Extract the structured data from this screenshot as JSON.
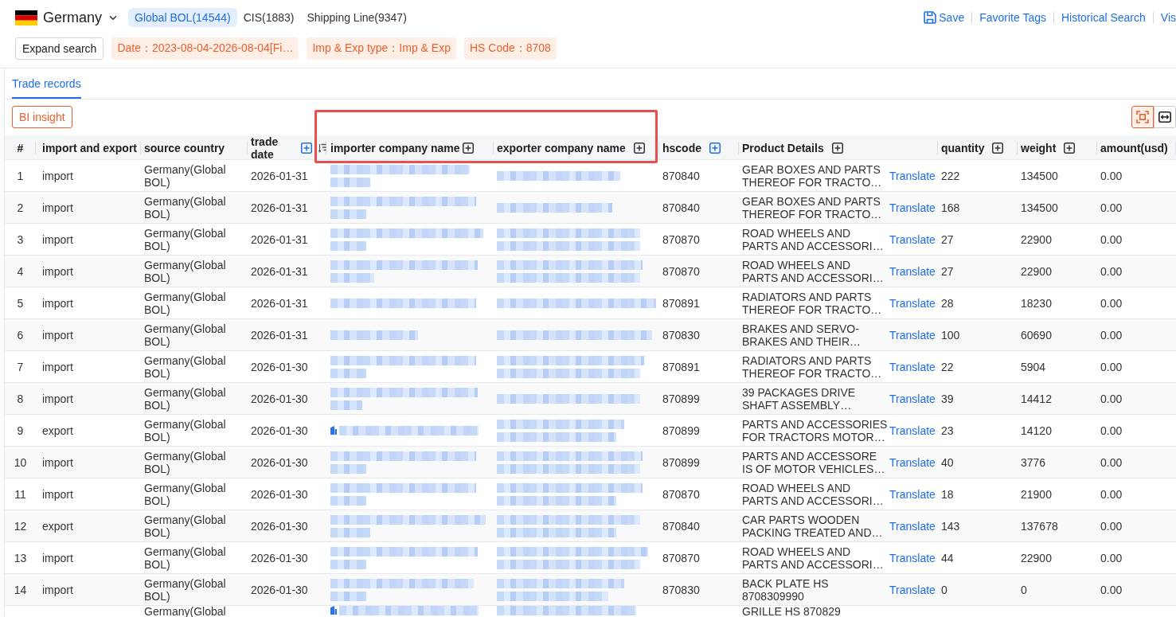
{
  "top_bar": {
    "country": "Germany",
    "source_tabs": [
      {
        "label": "Global BOL(14544)",
        "selected": true
      },
      {
        "label": "CIS(1883)",
        "selected": false
      },
      {
        "label": "Shipping Line(9347)",
        "selected": false
      }
    ],
    "links": [
      {
        "label": "Save",
        "kind": "save"
      },
      {
        "label": "Favorite Tags",
        "kind": "plain"
      },
      {
        "label": "Historical Search",
        "kind": "plain"
      },
      {
        "label": "Vis",
        "kind": "plain"
      }
    ],
    "expand_button": "Expand search",
    "filters": [
      "Date：2023-08-04-2026-08-04[Fi…",
      "Imp & Exp type：Imp & Exp",
      "HS Code：8708"
    ]
  },
  "record_tabs": [
    {
      "label": "Trade records",
      "selected": true
    }
  ],
  "toolbar": {
    "insight_button": "BI insight",
    "view_modes": [
      {
        "kind": "frame",
        "selected": true
      },
      {
        "kind": "stretch",
        "selected": false
      }
    ]
  },
  "table": {
    "columns": [
      {
        "label": "#",
        "expandable": false,
        "sortable": false,
        "highlighted": false
      },
      {
        "label": "import and export",
        "expandable": false,
        "sortable": false,
        "highlighted": false
      },
      {
        "label": "source country",
        "expandable": false,
        "sortable": false,
        "highlighted": false
      },
      {
        "label": "trade date",
        "expandable": true,
        "expand_active": true,
        "sortable": true,
        "highlighted": false
      },
      {
        "label": "importer company name",
        "expandable": true,
        "expand_active": false,
        "sortable": false,
        "highlighted": true
      },
      {
        "label": "exporter company name",
        "expandable": true,
        "expand_active": false,
        "sortable": false,
        "highlighted": true
      },
      {
        "label": "hscode",
        "expandable": true,
        "expand_active": true,
        "sortable": false,
        "highlighted": false
      },
      {
        "label": "Product Details",
        "expandable": true,
        "expand_active": false,
        "sortable": false,
        "highlighted": false
      },
      {
        "label": "quantity",
        "expandable": true,
        "expand_active": false,
        "sortable": false,
        "highlighted": false
      },
      {
        "label": "weight",
        "expandable": true,
        "expand_active": false,
        "sortable": false,
        "highlighted": false
      },
      {
        "label": "amount(usd)",
        "expandable": false,
        "sortable": false,
        "highlighted": false
      }
    ],
    "rows": [
      {
        "no": "1",
        "type": "import",
        "source": "Germany(Global BOL)",
        "date": "2026-01-31",
        "importer_redacted": true,
        "importer_icon": false,
        "exporter_redacted": true,
        "hscode": "870840",
        "product": "GEAR BOXES AND PARTS THEREOF FOR TRACTO…",
        "translate": "Translate",
        "quantity": "222",
        "weight": "134500",
        "amount": "0.00",
        "cut_off": false
      },
      {
        "no": "2",
        "type": "import",
        "source": "Germany(Global BOL)",
        "date": "2026-01-31",
        "importer_redacted": true,
        "importer_icon": false,
        "exporter_redacted": true,
        "hscode": "870840",
        "product": "GEAR BOXES AND PARTS THEREOF FOR TRACTO…",
        "translate": "Translate",
        "quantity": "168",
        "weight": "134500",
        "amount": "0.00",
        "cut_off": false
      },
      {
        "no": "3",
        "type": "import",
        "source": "Germany(Global BOL)",
        "date": "2026-01-31",
        "importer_redacted": true,
        "importer_icon": false,
        "exporter_redacted": true,
        "hscode": "870870",
        "product": "ROAD WHEELS AND PARTS AND ACCESSORI…",
        "translate": "Translate",
        "quantity": "27",
        "weight": "22900",
        "amount": "0.00",
        "cut_off": false
      },
      {
        "no": "4",
        "type": "import",
        "source": "Germany(Global BOL)",
        "date": "2026-01-31",
        "importer_redacted": true,
        "importer_icon": false,
        "exporter_redacted": true,
        "hscode": "870870",
        "product": "ROAD WHEELS AND PARTS AND ACCESSORI…",
        "translate": "Translate",
        "quantity": "27",
        "weight": "22900",
        "amount": "0.00",
        "cut_off": false
      },
      {
        "no": "5",
        "type": "import",
        "source": "Germany(Global BOL)",
        "date": "2026-01-31",
        "importer_redacted": true,
        "importer_icon": false,
        "exporter_redacted": true,
        "hscode": "870891",
        "product": "RADIATORS AND PARTS THEREOF FOR TRACTO…",
        "translate": "Translate",
        "quantity": "28",
        "weight": "18230",
        "amount": "0.00",
        "cut_off": false
      },
      {
        "no": "6",
        "type": "import",
        "source": "Germany(Global BOL)",
        "date": "2026-01-31",
        "importer_redacted": true,
        "importer_icon": false,
        "exporter_redacted": true,
        "hscode": "870830",
        "product": "BRAKES AND SERVO-BRAKES AND THEIR…",
        "translate": "Translate",
        "quantity": "100",
        "weight": "60690",
        "amount": "0.00",
        "cut_off": false
      },
      {
        "no": "7",
        "type": "import",
        "source": "Germany(Global BOL)",
        "date": "2026-01-30",
        "importer_redacted": true,
        "importer_icon": false,
        "exporter_redacted": true,
        "hscode": "870891",
        "product": "RADIATORS AND PARTS THEREOF FOR TRACTO…",
        "translate": "Translate",
        "quantity": "22",
        "weight": "5904",
        "amount": "0.00",
        "cut_off": false
      },
      {
        "no": "8",
        "type": "import",
        "source": "Germany(Global BOL)",
        "date": "2026-01-30",
        "importer_redacted": true,
        "importer_icon": false,
        "exporter_redacted": true,
        "hscode": "870899",
        "product": "39 PACKAGES DRIVE SHAFT ASSEMBLY…",
        "translate": "Translate",
        "quantity": "39",
        "weight": "14412",
        "amount": "0.00",
        "cut_off": false
      },
      {
        "no": "9",
        "type": "export",
        "source": "Germany(Global BOL)",
        "date": "2026-01-30",
        "importer_redacted": true,
        "importer_icon": true,
        "exporter_redacted": true,
        "hscode": "870899",
        "product": "PARTS AND ACCESSORIES FOR TRACTORS MOTOR…",
        "translate": "Translate",
        "quantity": "23",
        "weight": "14120",
        "amount": "0.00",
        "cut_off": false
      },
      {
        "no": "10",
        "type": "import",
        "source": "Germany(Global BOL)",
        "date": "2026-01-30",
        "importer_redacted": true,
        "importer_icon": false,
        "exporter_redacted": true,
        "hscode": "870899",
        "product": "PARTS AND ACCESSORE IS OF MOTOR VEHICLES…",
        "translate": "Translate",
        "quantity": "40",
        "weight": "3776",
        "amount": "0.00",
        "cut_off": false
      },
      {
        "no": "11",
        "type": "import",
        "source": "Germany(Global BOL)",
        "date": "2026-01-30",
        "importer_redacted": true,
        "importer_icon": false,
        "exporter_redacted": true,
        "hscode": "870870",
        "product": "ROAD WHEELS AND PARTS AND ACCESSORI…",
        "translate": "Translate",
        "quantity": "18",
        "weight": "21900",
        "amount": "0.00",
        "cut_off": false
      },
      {
        "no": "12",
        "type": "export",
        "source": "Germany(Global BOL)",
        "date": "2026-01-30",
        "importer_redacted": true,
        "importer_icon": false,
        "exporter_redacted": true,
        "hscode": "870840",
        "product": "CAR PARTS WOODEN PACKING TREATED AND…",
        "translate": "Translate",
        "quantity": "143",
        "weight": "137678",
        "amount": "0.00",
        "cut_off": false
      },
      {
        "no": "13",
        "type": "import",
        "source": "Germany(Global BOL)",
        "date": "2026-01-30",
        "importer_redacted": true,
        "importer_icon": false,
        "exporter_redacted": true,
        "hscode": "870870",
        "product": "ROAD WHEELS AND PARTS AND ACCESSORI…",
        "translate": "Translate",
        "quantity": "44",
        "weight": "22900",
        "amount": "0.00",
        "cut_off": false
      },
      {
        "no": "14",
        "type": "import",
        "source": "Germany(Global BOL)",
        "date": "2026-01-30",
        "importer_redacted": true,
        "importer_icon": false,
        "exporter_redacted": true,
        "hscode": "870830",
        "product": "BACK PLATE HS 8708309990",
        "translate": "Translate",
        "quantity": "0",
        "weight": "0",
        "amount": "0.00",
        "cut_off": false
      },
      {
        "source": "Germany(Global",
        "importer_redacted": true,
        "importer_icon": true,
        "exporter_redacted": true,
        "product": "GRILLE HS 870829",
        "cut_off": true
      }
    ]
  }
}
